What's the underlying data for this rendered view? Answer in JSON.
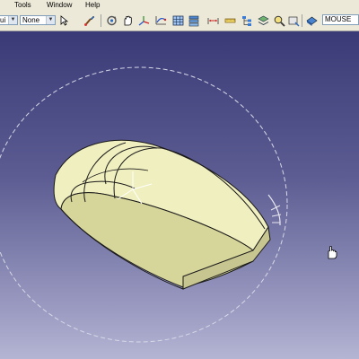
{
  "menubar": {
    "items": [
      {
        "label": "Tools"
      },
      {
        "label": "Window"
      },
      {
        "label": "Help"
      }
    ]
  },
  "toolbar": {
    "combo_left_value": "ui",
    "combo_none_value": "None",
    "search_value": "MOUSE",
    "icons": [
      "paint-brush-icon",
      "rotate-icon",
      "hand-icon",
      "axis-system-icon",
      "grid-icon",
      "stack-icon",
      "dimension-icon",
      "measure-icon",
      "tree-icon",
      "zoom-icon",
      "render-icon"
    ]
  },
  "viewport": {
    "model": "computer-mouse",
    "colors": {
      "background_top": "#3a3a77",
      "background_bottom": "#b4b4d3",
      "body": "#f0efbf",
      "body_side": "#d6d59a",
      "edges": "#1a1a1a",
      "compass_circle": "#d8d8e8"
    }
  }
}
